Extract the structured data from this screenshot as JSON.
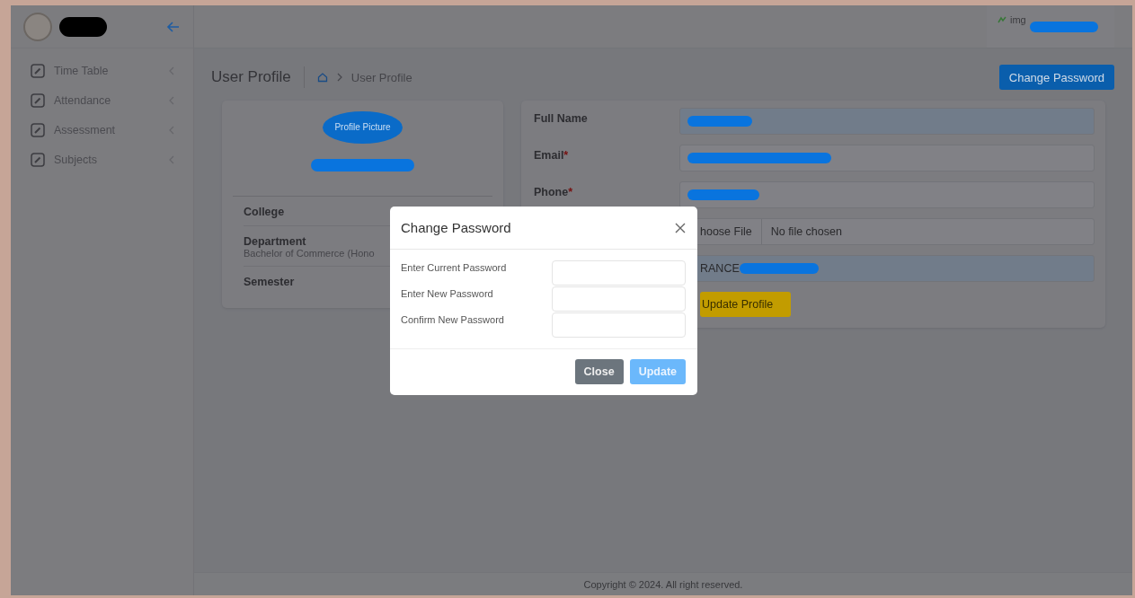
{
  "header": {
    "avatar_alt": "img"
  },
  "sidebar": {
    "items": [
      {
        "label": "Time Table"
      },
      {
        "label": "Attendance"
      },
      {
        "label": "Assessment"
      },
      {
        "label": "Subjects"
      }
    ]
  },
  "page": {
    "title": "User Profile",
    "breadcrumb": "User Profile",
    "action_button": "Change Password"
  },
  "profile_card": {
    "picture_alt": "Profile Picture",
    "rows": [
      {
        "label": "College"
      },
      {
        "label": "Department",
        "value": "Bachelor of Commerce (Hono"
      },
      {
        "label": "Semester"
      }
    ]
  },
  "form": {
    "fields": [
      {
        "kind": "text",
        "label": "Full Name",
        "readonly": true
      },
      {
        "kind": "text",
        "label": "Email",
        "required_mark": "*",
        "readonly": false
      },
      {
        "kind": "text",
        "label": "Phone",
        "required_mark": "*",
        "readonly": false
      },
      {
        "kind": "file",
        "button": "hoose File",
        "value": "No file chosen"
      },
      {
        "kind": "text",
        "value": "RANCE",
        "readonly": true
      }
    ],
    "submit": "Update Profile"
  },
  "dialog": {
    "title": "Change Password",
    "fields": [
      {
        "label": "Enter Current Password"
      },
      {
        "label": "Enter New Password"
      },
      {
        "label": "Confirm New Password"
      }
    ],
    "buttons": [
      {
        "label": "Close",
        "kind": "secondary"
      },
      {
        "label": "Update",
        "kind": "primary"
      }
    ]
  },
  "footer": "Copyright © 2024. All right reserved."
}
